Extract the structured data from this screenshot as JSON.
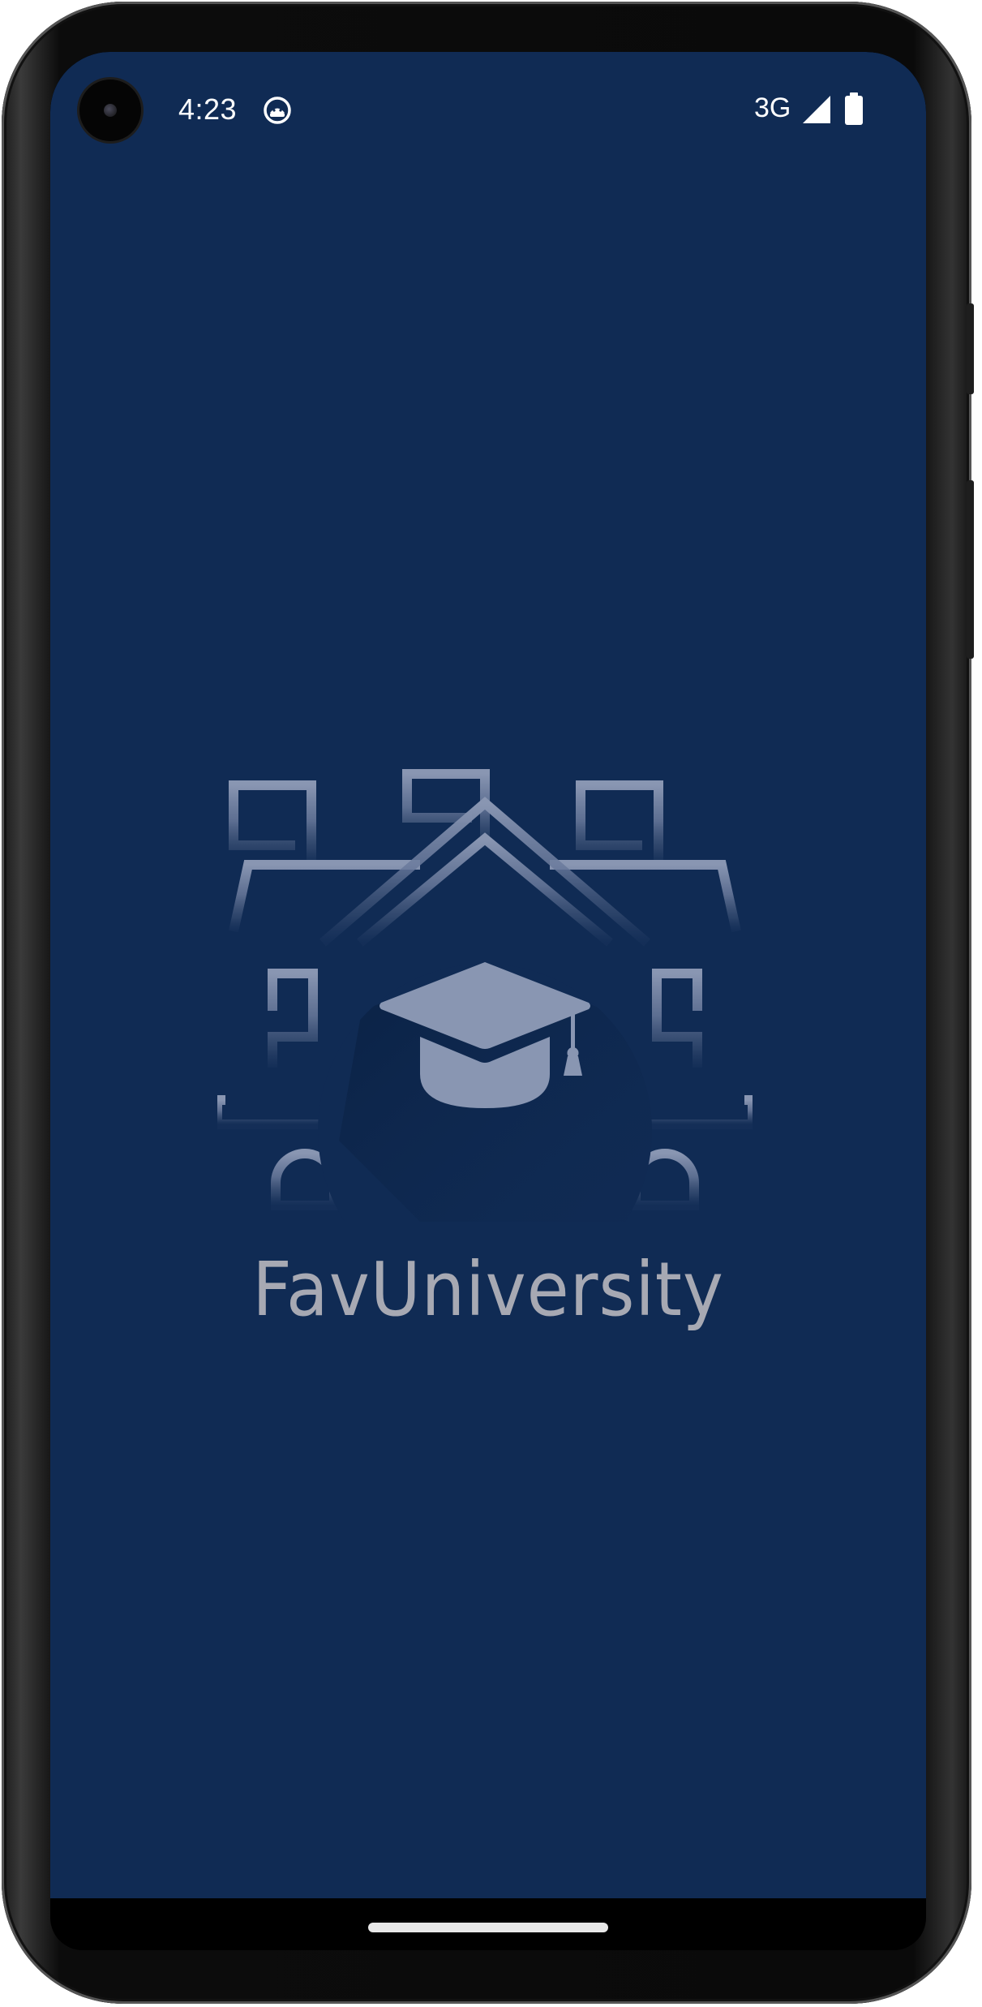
{
  "status_bar": {
    "time": "4:23",
    "network": "3G",
    "notification_icon": "android-debug-icon",
    "signal_icon": "cellular-signal-icon",
    "battery_icon": "battery-full-icon"
  },
  "splash": {
    "logo_icon": "university-graduation-cap-icon",
    "app_name": "FavUniversity",
    "background_color": "#102b54",
    "logo_color": "#8996b2"
  },
  "navigation": {
    "gesture_bar": "home-gesture-pill"
  }
}
